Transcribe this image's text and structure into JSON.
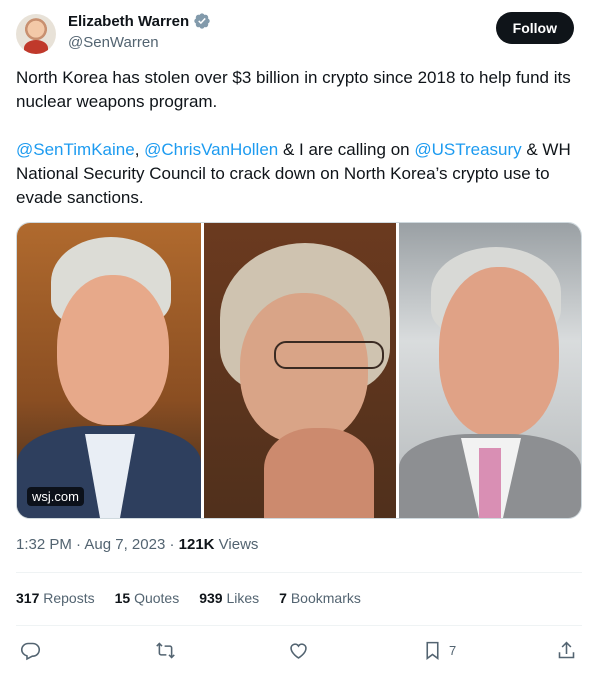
{
  "author": {
    "display_name": "Elizabeth Warren",
    "handle": "@SenWarren",
    "verified": true,
    "follow_label": "Follow"
  },
  "tweet": {
    "line1": "North Korea has stolen over $3 billion in crypto since 2018 to help fund its nuclear weapons program.",
    "mention1": "@SenTimKaine",
    "sep1": ", ",
    "mention2": "@ChrisVanHollen",
    "mid": " & I are calling on ",
    "mention3": "@USTreasury",
    "tail": " & WH National Security Council to crack down on North Korea’s crypto use to evade sanctions."
  },
  "media": {
    "source": "wsj.com"
  },
  "meta": {
    "time": "1:32 PM",
    "date": "Aug 7, 2023",
    "views_count": "121K",
    "views_label": "Views"
  },
  "stats": {
    "reposts_count": "317",
    "reposts_label": "Reposts",
    "quotes_count": "15",
    "quotes_label": "Quotes",
    "likes_count": "939",
    "likes_label": "Likes",
    "bookmarks_count": "7",
    "bookmarks_label": "Bookmarks"
  },
  "actions": {
    "bookmark_count": "7"
  },
  "colors": {
    "link": "#1d9bf0",
    "text": "#0f1419",
    "secondary": "#536471",
    "verified": "#829aab"
  },
  "icons": [
    "verified-badge-icon",
    "reply-icon",
    "repost-icon",
    "like-icon",
    "bookmark-icon",
    "share-icon"
  ]
}
